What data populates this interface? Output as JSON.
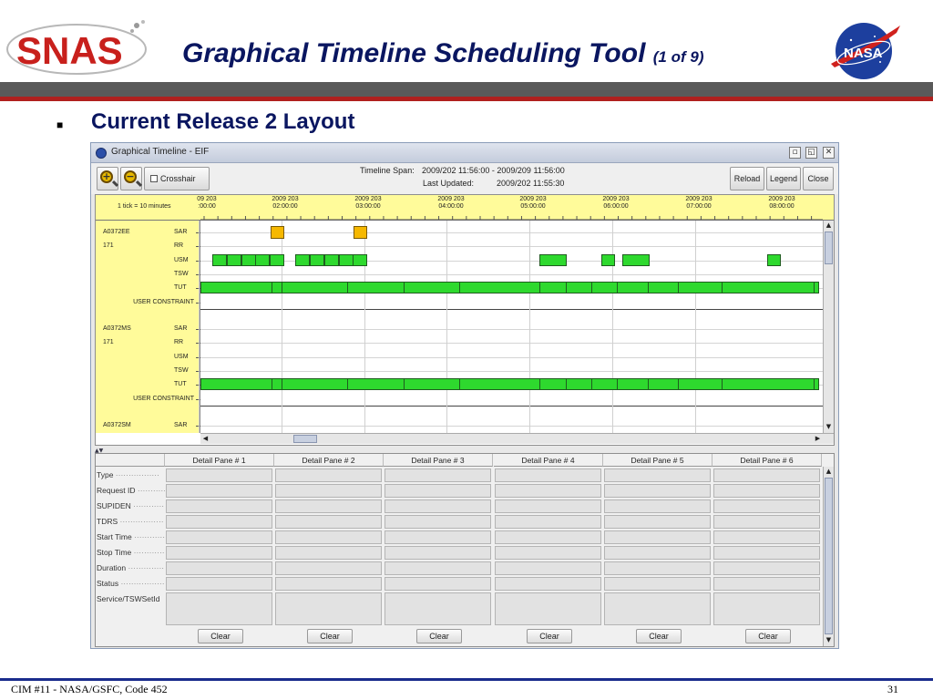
{
  "slide": {
    "title": "Graphical Timeline Scheduling Tool",
    "title_suffix": "(1 of 9)",
    "bullet": "Current Release 2 Layout",
    "footer_left": "CIM #11 - NASA/GSFC, Code 452",
    "page_number": "31",
    "logo_text": "SNAS",
    "nasa_logo_text": "NASA",
    "colors": {
      "title": "#0a1660",
      "bar_dark": "#5a5a5a",
      "bar_red": "#b0201e",
      "footer_line": "#1a2c8c"
    }
  },
  "window": {
    "title": "Graphical Timeline - EIF",
    "icons": [
      "app-icon",
      "minimize-icon",
      "maximize-icon",
      "close-icon"
    ]
  },
  "toolbar": {
    "zoom_in_symbol": "+",
    "zoom_out_symbol": "−",
    "crosshair_label": "Crosshair",
    "timespan_label": "Timeline Span:",
    "timespan_value": "2009/202 11:56:00  -  2009/209 11:56:00",
    "updated_label": "Last Updated:",
    "updated_value": "2009/202 11:55:30",
    "reload_label": "Reload",
    "legend_label": "Legend",
    "close_label": "Close"
  },
  "timeline": {
    "tick_note": "1 tick = 10 minutes",
    "time_labels": [
      {
        "date": "09 203",
        "time": ":00:00"
      },
      {
        "date": "2009 203",
        "time": "02:00:00"
      },
      {
        "date": "2009 203",
        "time": "03:00:00"
      },
      {
        "date": "2009 203",
        "time": "04:00:00"
      },
      {
        "date": "2009 203",
        "time": "05:00:00"
      },
      {
        "date": "2009 203",
        "time": "06:00:00"
      },
      {
        "date": "2009 203",
        "time": "07:00:00"
      },
      {
        "date": "2009 203",
        "time": "08:00:00"
      }
    ],
    "rows": [
      {
        "group": "A0372EE",
        "label": "SAR"
      },
      {
        "group": "171",
        "label": "RR"
      },
      {
        "group": "",
        "label": "USM"
      },
      {
        "group": "",
        "label": "TSW"
      },
      {
        "group": "",
        "label": "TUT"
      },
      {
        "group": "",
        "label": "USER CONSTRAINT"
      },
      {
        "group": "A0372MS",
        "label": "SAR"
      },
      {
        "group": "171",
        "label": "RR"
      },
      {
        "group": "",
        "label": "USM"
      },
      {
        "group": "",
        "label": "TSW"
      },
      {
        "group": "",
        "label": "TUT"
      },
      {
        "group": "",
        "label": "USER CONSTRAINT"
      },
      {
        "group": "A0372SM",
        "label": "SAR"
      }
    ],
    "colors": {
      "header_bg": "#fffb9a",
      "block_green": "#2ed92e",
      "block_orange": "#f6b800"
    }
  },
  "detail": {
    "pane_headers": [
      "Detail Pane # 1",
      "Detail Pane # 2",
      "Detail Pane # 3",
      "Detail Pane # 4",
      "Detail Pane # 5",
      "Detail Pane # 6"
    ],
    "fields": [
      "Type",
      "Request ID",
      "SUPIDEN",
      "TDRS",
      "Start Time",
      "Stop Time",
      "Duration",
      "Status",
      "Service/TSWSetId"
    ],
    "clear_label": "Clear"
  }
}
